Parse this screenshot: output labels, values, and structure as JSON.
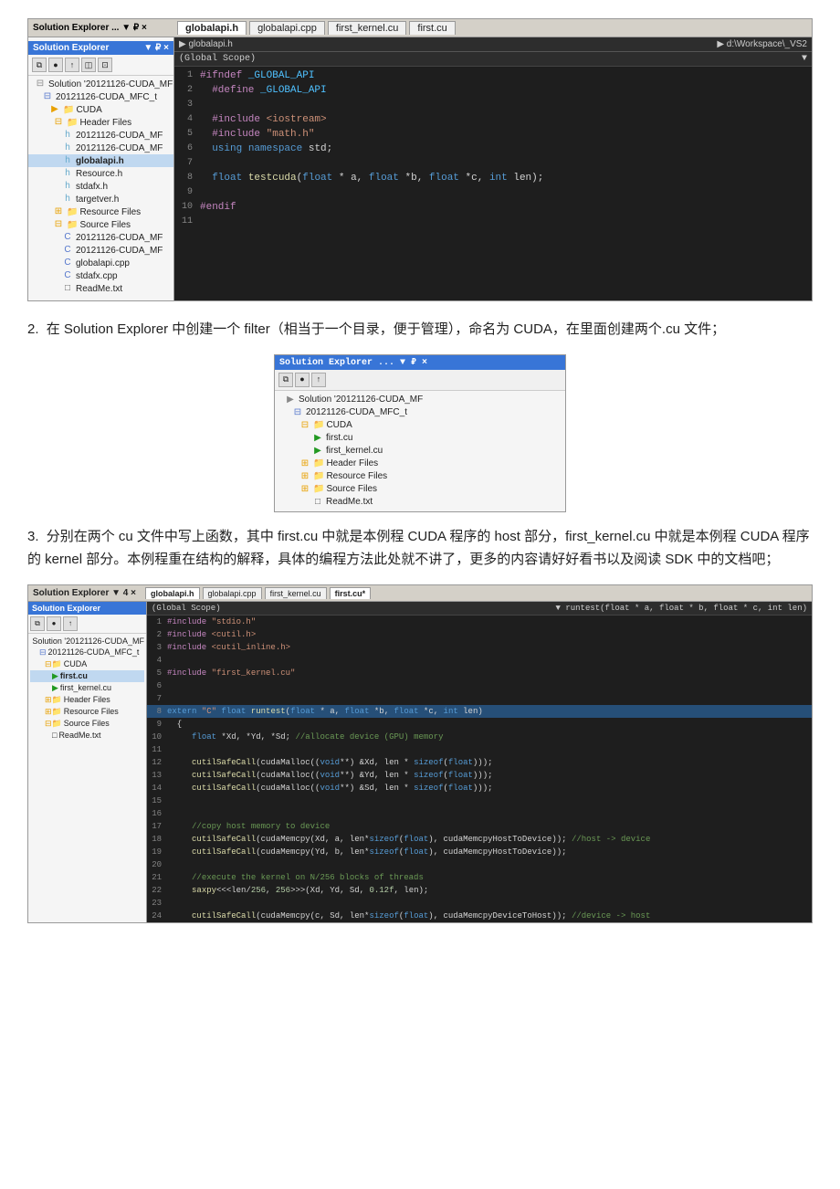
{
  "section1": {
    "ide": {
      "title": "Solution Explorer ... ▼ ₽ ×",
      "tabs": [
        "globalapi.h",
        "globalapi.cpp",
        "first_kernel.cu",
        "first.cu"
      ],
      "active_tab": "globalapi.h",
      "path": "▶ globalapi.h",
      "path_right": "▶ d:\\Workspace\\_VS2",
      "scope": "(Global Scope)",
      "solution_tree": [
        {
          "indent": 0,
          "type": "solution",
          "label": "Solution '20121126-CUDA_MF"
        },
        {
          "indent": 1,
          "type": "project",
          "label": "20121126-CUDA_MFC_t"
        },
        {
          "indent": 2,
          "type": "folder",
          "label": "CUDA"
        },
        {
          "indent": 3,
          "type": "folder",
          "label": "Header Files"
        },
        {
          "indent": 4,
          "type": "h",
          "label": "20121126-CUDA_MF"
        },
        {
          "indent": 4,
          "type": "h",
          "label": "20121126-CUDA_MF"
        },
        {
          "indent": 4,
          "type": "h",
          "label": "globalapi.h"
        },
        {
          "indent": 4,
          "type": "h",
          "label": "Resource.h"
        },
        {
          "indent": 4,
          "type": "h",
          "label": "stdafx.h"
        },
        {
          "indent": 4,
          "type": "h",
          "label": "targetver.h"
        },
        {
          "indent": 3,
          "type": "folder",
          "label": "Resource Files"
        },
        {
          "indent": 3,
          "type": "folder",
          "label": "Source Files"
        },
        {
          "indent": 4,
          "type": "cpp",
          "label": "20121126-CUDA_MF"
        },
        {
          "indent": 4,
          "type": "cpp",
          "label": "20121126-CUDA_MF"
        },
        {
          "indent": 4,
          "type": "cpp",
          "label": "globalapi.cpp"
        },
        {
          "indent": 4,
          "type": "cpp",
          "label": "stdafx.cpp"
        },
        {
          "indent": 4,
          "type": "txt",
          "label": "ReadMe.txt"
        }
      ],
      "code_lines": [
        {
          "num": "1",
          "content": "#ifndef _GLOBAL_API",
          "type": "pp"
        },
        {
          "num": "2",
          "content": "  #define _GLOBAL_API",
          "type": "pp"
        },
        {
          "num": "3",
          "content": ""
        },
        {
          "num": "4",
          "content": "  #include <iostream>",
          "type": "pp"
        },
        {
          "num": "5",
          "content": "  #include \"math.h\"",
          "type": "pp"
        },
        {
          "num": "6",
          "content": "  using namespace std;",
          "type": "kw"
        },
        {
          "num": "7",
          "content": ""
        },
        {
          "num": "8",
          "content": "  float testcuda(float * a, float *b, float *c, int len);",
          "type": "normal"
        },
        {
          "num": "9",
          "content": ""
        },
        {
          "num": "10",
          "content": "#endif",
          "type": "pp"
        },
        {
          "num": "11",
          "content": ""
        }
      ]
    }
  },
  "step2": {
    "text": "在 Solution Explorer 中创建一个 filter（相当于一个目录，便于管理），命名为 CUDA，在里面创建两个.cu 文件；",
    "num": "2.",
    "ide": {
      "title": "Solution Explorer ... ▼ ₽ ×",
      "solution_tree": [
        {
          "indent": 0,
          "type": "solution",
          "label": "Solution '20121126-CUDA_MF"
        },
        {
          "indent": 1,
          "type": "project",
          "label": "20121126-CUDA_MFC_t"
        },
        {
          "indent": 2,
          "type": "folder",
          "label": "CUDA"
        },
        {
          "indent": 3,
          "type": "cu",
          "label": "first.cu"
        },
        {
          "indent": 3,
          "type": "cu",
          "label": "first_kernel.cu"
        },
        {
          "indent": 2,
          "type": "folder",
          "label": "Header Files"
        },
        {
          "indent": 2,
          "type": "folder",
          "label": "Resource Files"
        },
        {
          "indent": 2,
          "type": "folder",
          "label": "Source Files"
        },
        {
          "indent": 2,
          "type": "txt",
          "label": "ReadMe.txt"
        }
      ]
    }
  },
  "step3": {
    "text1": "分别在两个 cu 文件中写上函数，其中 first.cu 中就是本例程 CUDA 程序的 host 部分，first_kernel.cu 中就是本例程 CUDA 程序的 kernel 部分。本例程重在结构的解释，具体的编程方法此处就不讲了，更多的内容请好好看书以及阅读 SDK 中的文档吧；",
    "num": "3.",
    "ide": {
      "title": "Solution Explorer ▼ 4 ×",
      "tabs": [
        "globalapi.h",
        "globalapi.cpp",
        "first_kernel.cu",
        "first.cu*"
      ],
      "active_tab": "first.cu*",
      "scope": "(Global Scope)",
      "scope_right": "▼ runtest(float * a, float * b, float * c, int len)",
      "solution_tree": [
        {
          "indent": 0,
          "type": "solution",
          "label": "Solution '20121126-CUDA_MF"
        },
        {
          "indent": 1,
          "type": "project",
          "label": "20121126-CUDA_MFC_t"
        },
        {
          "indent": 2,
          "type": "folder",
          "label": "CUDA"
        },
        {
          "indent": 3,
          "type": "cu",
          "label": "first.cu",
          "active": true
        },
        {
          "indent": 3,
          "type": "cu",
          "label": "first_kernel.cu"
        },
        {
          "indent": 2,
          "type": "folder",
          "label": "Header Files"
        },
        {
          "indent": 2,
          "type": "folder",
          "label": "Resource Files"
        },
        {
          "indent": 2,
          "type": "folder",
          "label": "Source Files"
        },
        {
          "indent": 3,
          "type": "txt",
          "label": "ReadMe.txt"
        }
      ],
      "code_lines": [
        {
          "num": "1",
          "content": "  #include \"stdio.h\""
        },
        {
          "num": "2",
          "content": "  #include <cutil.h>"
        },
        {
          "num": "3",
          "content": "  #include <cutil_inline.h>"
        },
        {
          "num": "4",
          "content": ""
        },
        {
          "num": "5",
          "content": "  #include \"first_kernel.cu\""
        },
        {
          "num": "6",
          "content": ""
        },
        {
          "num": "7",
          "content": ""
        },
        {
          "num": "8",
          "content": "extern \"C\" float runtest(float * a, float *b, float *c, int len)",
          "highlight": true
        },
        {
          "num": "9",
          "content": "  {"
        },
        {
          "num": "10",
          "content": "      float *Xd, *Yd, *Sd; //allocate device (GPU) memory"
        },
        {
          "num": "11",
          "content": ""
        },
        {
          "num": "12",
          "content": "      cutilSafeCall(cudaMalloc((void**) &Xd, len * sizeof(float)));"
        },
        {
          "num": "13",
          "content": "      cutilSafeCall(cudaMalloc((void**) &Yd, len * sizeof(float)));"
        },
        {
          "num": "14",
          "content": "      cutilSafeCall(cudaMalloc((void**) &Sd, len * sizeof(float)));"
        },
        {
          "num": "15",
          "content": ""
        },
        {
          "num": "16",
          "content": ""
        },
        {
          "num": "17",
          "content": "      //copy host memory to device"
        },
        {
          "num": "18",
          "content": "      cutilSafeCall(cudaMemcpy(Xd, a, len*sizeof(float), cudaMemcpyHostToDevice)); //host -> device"
        },
        {
          "num": "19",
          "content": "      cutilSafeCall(cudaMemcpy(Yd, b, len*sizeof(float), cudaMemcpyHostToDevice));"
        },
        {
          "num": "20",
          "content": ""
        },
        {
          "num": "21",
          "content": "      //execute the kernel on N/256 blocks of threads"
        },
        {
          "num": "22",
          "content": "      saxpy<<<len/256, 256>>>(Xd, Yd, Sd, 0.12f, len);"
        },
        {
          "num": "23",
          "content": ""
        },
        {
          "num": "24",
          "content": "      cutilSafeCall(cudaMemcpy(c, Sd, len*sizeof(float), cudaMemcpyDeviceToHost)); //device -> host"
        }
      ]
    }
  }
}
